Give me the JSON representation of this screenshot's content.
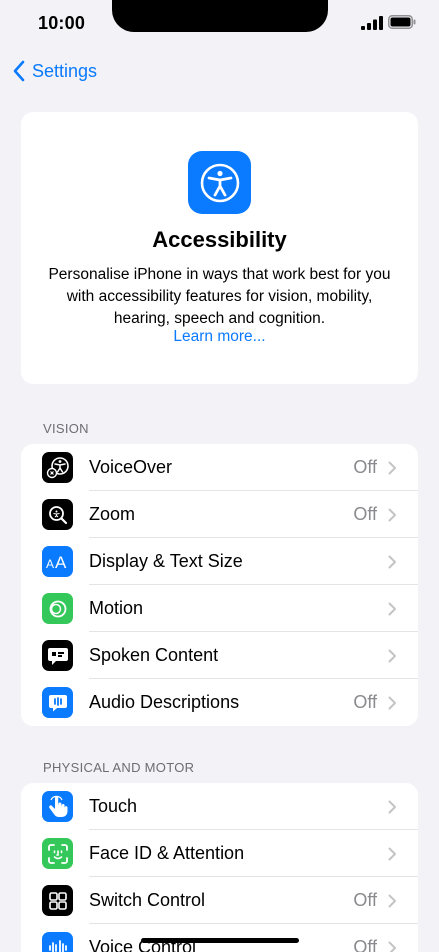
{
  "status_bar": {
    "time": "10:00"
  },
  "nav": {
    "back_label": "Settings"
  },
  "hero": {
    "title": "Accessibility",
    "description": "Personalise iPhone in ways that work best for you with accessibility features for vision, mobility, hearing, speech and cognition.",
    "link": "Learn more..."
  },
  "sections": [
    {
      "header": "VISION",
      "rows": [
        {
          "label": "VoiceOver",
          "value": "Off",
          "icon": "voiceover-icon",
          "color": "#000000"
        },
        {
          "label": "Zoom",
          "value": "Off",
          "icon": "zoom-icon",
          "color": "#000000"
        },
        {
          "label": "Display & Text Size",
          "value": "",
          "icon": "text-size-icon",
          "color": "#0a7aff"
        },
        {
          "label": "Motion",
          "value": "",
          "icon": "motion-icon",
          "color": "#34c759"
        },
        {
          "label": "Spoken Content",
          "value": "",
          "icon": "spoken-content-icon",
          "color": "#000000"
        },
        {
          "label": "Audio Descriptions",
          "value": "Off",
          "icon": "audio-descriptions-icon",
          "color": "#0a7aff"
        }
      ]
    },
    {
      "header": "PHYSICAL AND MOTOR",
      "rows": [
        {
          "label": "Touch",
          "value": "",
          "icon": "touch-icon",
          "color": "#0a7aff"
        },
        {
          "label": "Face ID & Attention",
          "value": "",
          "icon": "face-id-icon",
          "color": "#34c759"
        },
        {
          "label": "Switch Control",
          "value": "Off",
          "icon": "switch-control-icon",
          "color": "#000000"
        },
        {
          "label": "Voice Control",
          "value": "Off",
          "icon": "voice-control-icon",
          "color": "#0a7aff"
        }
      ]
    }
  ],
  "colors": {
    "accent": "#0a7aff",
    "background": "#f2f2f7",
    "secondary_text": "#8a8a8e"
  }
}
